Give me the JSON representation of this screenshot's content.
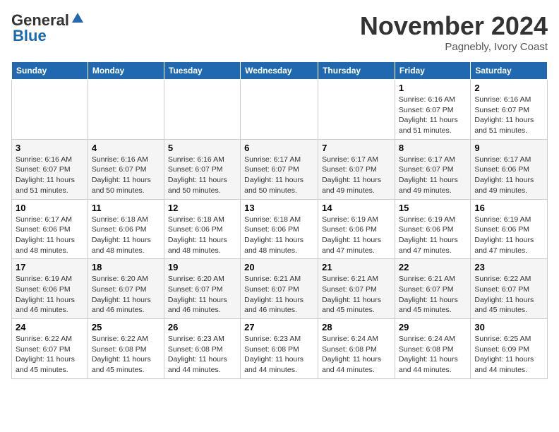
{
  "header": {
    "logo_general": "General",
    "logo_blue": "Blue",
    "month_title": "November 2024",
    "location": "Pagnebly, Ivory Coast"
  },
  "calendar": {
    "days_of_week": [
      "Sunday",
      "Monday",
      "Tuesday",
      "Wednesday",
      "Thursday",
      "Friday",
      "Saturday"
    ],
    "weeks": [
      [
        {
          "day": "",
          "info": ""
        },
        {
          "day": "",
          "info": ""
        },
        {
          "day": "",
          "info": ""
        },
        {
          "day": "",
          "info": ""
        },
        {
          "day": "",
          "info": ""
        },
        {
          "day": "1",
          "info": "Sunrise: 6:16 AM\nSunset: 6:07 PM\nDaylight: 11 hours\nand 51 minutes."
        },
        {
          "day": "2",
          "info": "Sunrise: 6:16 AM\nSunset: 6:07 PM\nDaylight: 11 hours\nand 51 minutes."
        }
      ],
      [
        {
          "day": "3",
          "info": "Sunrise: 6:16 AM\nSunset: 6:07 PM\nDaylight: 11 hours\nand 51 minutes."
        },
        {
          "day": "4",
          "info": "Sunrise: 6:16 AM\nSunset: 6:07 PM\nDaylight: 11 hours\nand 50 minutes."
        },
        {
          "day": "5",
          "info": "Sunrise: 6:16 AM\nSunset: 6:07 PM\nDaylight: 11 hours\nand 50 minutes."
        },
        {
          "day": "6",
          "info": "Sunrise: 6:17 AM\nSunset: 6:07 PM\nDaylight: 11 hours\nand 50 minutes."
        },
        {
          "day": "7",
          "info": "Sunrise: 6:17 AM\nSunset: 6:07 PM\nDaylight: 11 hours\nand 49 minutes."
        },
        {
          "day": "8",
          "info": "Sunrise: 6:17 AM\nSunset: 6:07 PM\nDaylight: 11 hours\nand 49 minutes."
        },
        {
          "day": "9",
          "info": "Sunrise: 6:17 AM\nSunset: 6:06 PM\nDaylight: 11 hours\nand 49 minutes."
        }
      ],
      [
        {
          "day": "10",
          "info": "Sunrise: 6:17 AM\nSunset: 6:06 PM\nDaylight: 11 hours\nand 48 minutes."
        },
        {
          "day": "11",
          "info": "Sunrise: 6:18 AM\nSunset: 6:06 PM\nDaylight: 11 hours\nand 48 minutes."
        },
        {
          "day": "12",
          "info": "Sunrise: 6:18 AM\nSunset: 6:06 PM\nDaylight: 11 hours\nand 48 minutes."
        },
        {
          "day": "13",
          "info": "Sunrise: 6:18 AM\nSunset: 6:06 PM\nDaylight: 11 hours\nand 48 minutes."
        },
        {
          "day": "14",
          "info": "Sunrise: 6:19 AM\nSunset: 6:06 PM\nDaylight: 11 hours\nand 47 minutes."
        },
        {
          "day": "15",
          "info": "Sunrise: 6:19 AM\nSunset: 6:06 PM\nDaylight: 11 hours\nand 47 minutes."
        },
        {
          "day": "16",
          "info": "Sunrise: 6:19 AM\nSunset: 6:06 PM\nDaylight: 11 hours\nand 47 minutes."
        }
      ],
      [
        {
          "day": "17",
          "info": "Sunrise: 6:19 AM\nSunset: 6:06 PM\nDaylight: 11 hours\nand 46 minutes."
        },
        {
          "day": "18",
          "info": "Sunrise: 6:20 AM\nSunset: 6:07 PM\nDaylight: 11 hours\nand 46 minutes."
        },
        {
          "day": "19",
          "info": "Sunrise: 6:20 AM\nSunset: 6:07 PM\nDaylight: 11 hours\nand 46 minutes."
        },
        {
          "day": "20",
          "info": "Sunrise: 6:21 AM\nSunset: 6:07 PM\nDaylight: 11 hours\nand 46 minutes."
        },
        {
          "day": "21",
          "info": "Sunrise: 6:21 AM\nSunset: 6:07 PM\nDaylight: 11 hours\nand 45 minutes."
        },
        {
          "day": "22",
          "info": "Sunrise: 6:21 AM\nSunset: 6:07 PM\nDaylight: 11 hours\nand 45 minutes."
        },
        {
          "day": "23",
          "info": "Sunrise: 6:22 AM\nSunset: 6:07 PM\nDaylight: 11 hours\nand 45 minutes."
        }
      ],
      [
        {
          "day": "24",
          "info": "Sunrise: 6:22 AM\nSunset: 6:07 PM\nDaylight: 11 hours\nand 45 minutes."
        },
        {
          "day": "25",
          "info": "Sunrise: 6:22 AM\nSunset: 6:08 PM\nDaylight: 11 hours\nand 45 minutes."
        },
        {
          "day": "26",
          "info": "Sunrise: 6:23 AM\nSunset: 6:08 PM\nDaylight: 11 hours\nand 44 minutes."
        },
        {
          "day": "27",
          "info": "Sunrise: 6:23 AM\nSunset: 6:08 PM\nDaylight: 11 hours\nand 44 minutes."
        },
        {
          "day": "28",
          "info": "Sunrise: 6:24 AM\nSunset: 6:08 PM\nDaylight: 11 hours\nand 44 minutes."
        },
        {
          "day": "29",
          "info": "Sunrise: 6:24 AM\nSunset: 6:08 PM\nDaylight: 11 hours\nand 44 minutes."
        },
        {
          "day": "30",
          "info": "Sunrise: 6:25 AM\nSunset: 6:09 PM\nDaylight: 11 hours\nand 44 minutes."
        }
      ]
    ]
  }
}
